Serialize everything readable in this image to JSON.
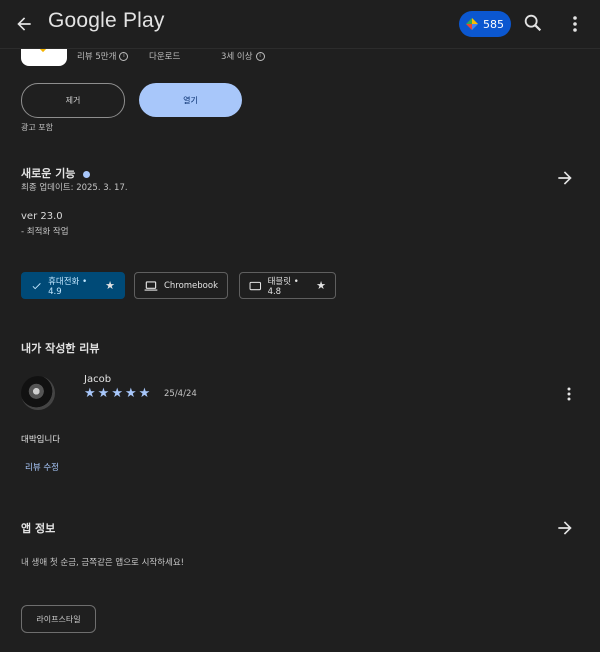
{
  "header": {
    "brand": "Google Play",
    "points": "585",
    "accent": "#0b57d0"
  },
  "stats": [
    {
      "value": "리뷰 5만개"
    },
    {
      "value": "다운로드"
    },
    {
      "value": "3세 이상"
    }
  ],
  "actions": {
    "uninstall_label": "제거",
    "open_label": "열기",
    "ads_note": "광고 포함"
  },
  "whats_new": {
    "title": "새로운 기능",
    "updated": "최종 업데이트: 2025. 3. 17.",
    "version": "ver 23.0",
    "note": "- 최적화 작업"
  },
  "device_chips": [
    {
      "label": "휴대전화 • 4.9",
      "icon": "check-icon",
      "selected": true
    },
    {
      "label": "Chromebook",
      "icon": "laptop-icon",
      "selected": false
    },
    {
      "label": "태블릿 • 4.8",
      "icon": "tablet-icon",
      "selected": false
    }
  ],
  "my_review": {
    "title": "내가 작성한 리뷰",
    "reviewer": "Jacob",
    "rating": 5,
    "date": "25/4/24",
    "text": "대박입니다",
    "edit_label": "리뷰 수정"
  },
  "app_info": {
    "title": "앱 정보",
    "description": "내 생애 첫 순금, 금쪽같은 앱으로 시작하세요!",
    "tag": "라이프스타일"
  },
  "colors": {
    "background": "#1f1f1f",
    "primary_button": "#a8c7fa",
    "selected_chip": "#004a77",
    "star": "#a8c7fa"
  }
}
